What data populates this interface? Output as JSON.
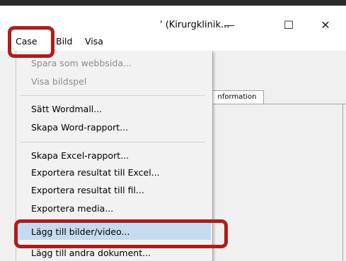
{
  "window": {
    "title": "' (Kirurgklinik...",
    "minimize_glyph": "—",
    "maximize_glyph": "☐",
    "close_glyph": "✕"
  },
  "menubar": {
    "items": [
      {
        "label": "Case"
      },
      {
        "label": "Bild"
      },
      {
        "label": "Visa"
      }
    ]
  },
  "tab": {
    "label": "nformation"
  },
  "dropdown": {
    "items": [
      {
        "label": "Spara som webbsida...",
        "enabled": false
      },
      {
        "label": "Visa bildspel",
        "enabled": false
      },
      {
        "label": "Sätt Wordmall...",
        "enabled": true
      },
      {
        "label": "Skapa Word-rapport...",
        "enabled": true
      },
      {
        "label": "Skapa Excel-rapport...",
        "enabled": true
      },
      {
        "label": "Exportera resultat till Excel...",
        "enabled": true
      },
      {
        "label": "Exportera resultat till fil...",
        "enabled": true
      },
      {
        "label": "Exportera media...",
        "enabled": true
      },
      {
        "label": "Lägg till bilder/video...",
        "enabled": true,
        "highlighted": true
      },
      {
        "label": "Lägg till andra dokument...",
        "enabled": true
      }
    ]
  },
  "colors": {
    "highlight": "#c5dbf0",
    "annotation": "#b01c1c",
    "disabled_text": "#8c8c8c"
  }
}
